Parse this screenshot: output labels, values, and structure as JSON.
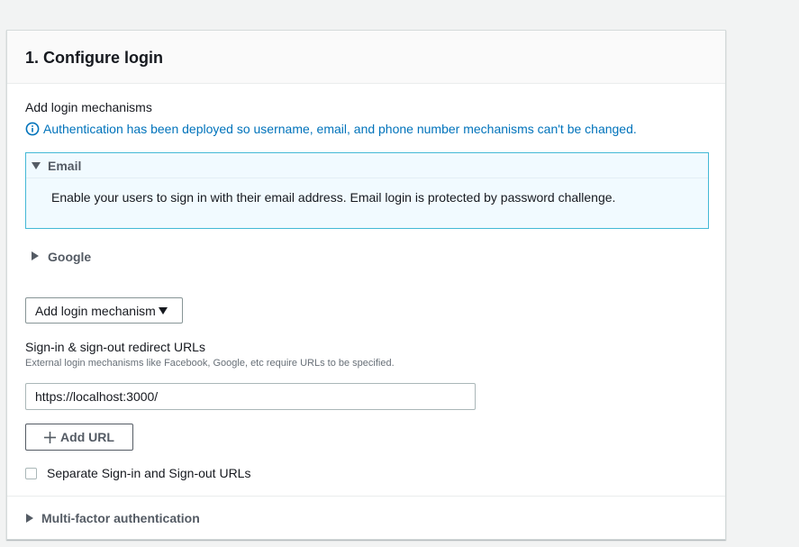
{
  "panel": {
    "title": "1. Configure login"
  },
  "login_mechanisms": {
    "label": "Add login mechanisms",
    "info_text": "Authentication has been deployed so username, email, and phone number mechanisms can't be changed.",
    "email": {
      "title": "Email",
      "description": "Enable your users to sign in with their email address. Email login is protected by password challenge.",
      "expanded": true
    },
    "google": {
      "title": "Google",
      "expanded": false
    },
    "add_button_label": "Add login mechanism"
  },
  "redirect": {
    "label": "Sign-in & sign-out redirect URLs",
    "hint": "External login mechanisms like Facebook, Google, etc require URLs to be specified.",
    "url_value": "https://localhost:3000/",
    "add_url_label": "Add URL",
    "separate_checkbox_label": "Separate Sign-in and Sign-out URLs",
    "separate_checked": false
  },
  "mfa": {
    "title": "Multi-factor authentication",
    "expanded": false
  },
  "colors": {
    "info_blue": "#0073bb",
    "email_bg": "#f1faff",
    "email_border": "#44b9d6",
    "page_bg": "#f2f3f3"
  },
  "icons": {
    "info": "info-icon",
    "expand_down": "caret-down-icon",
    "collapse_right": "caret-right-icon",
    "plus": "plus-icon"
  }
}
